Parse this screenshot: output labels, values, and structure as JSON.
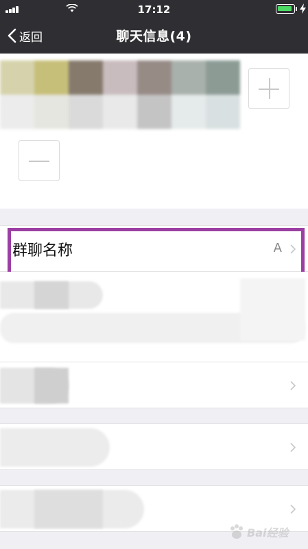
{
  "status_bar": {
    "time": "17:12",
    "battery_level": 0.8,
    "battery_color": "#4cd964"
  },
  "nav_bar": {
    "back_label": "返回",
    "title": "聊天信息(4)",
    "background": "#2f2f33"
  },
  "members": {
    "add_icon": "plus-icon",
    "remove_icon": "minus-icon"
  },
  "group_name_cell": {
    "label": "群聊名称",
    "value": "A"
  },
  "highlight_color": "#9c3fa3",
  "watermark": {
    "text": "Bai经验"
  }
}
